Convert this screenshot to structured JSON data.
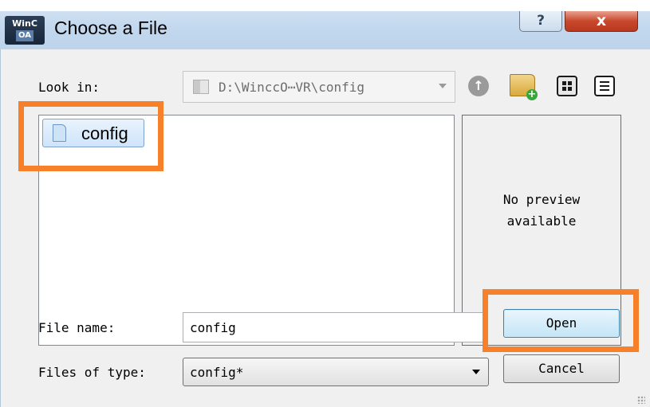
{
  "window": {
    "title": "Choose a File",
    "app_icon_top": "WinC",
    "app_icon_bottom": "OA",
    "help_glyph": "?",
    "close_glyph": "x"
  },
  "look_in": {
    "label": "Look in:",
    "path": "D:\\WinccO⋯VR\\config"
  },
  "toolbar": {
    "icons": [
      "up-arrow-icon",
      "new-folder-icon",
      "list-view-icon",
      "detail-view-icon"
    ]
  },
  "file_list": {
    "items": [
      {
        "name": "config",
        "icon": "document-icon",
        "selected": true
      }
    ]
  },
  "preview": {
    "text": "No preview\navailable"
  },
  "file_name": {
    "label": "File name:",
    "value": "config"
  },
  "files_of_type": {
    "label": "Files of type:",
    "value": "config*"
  },
  "buttons": {
    "open": "Open",
    "cancel": "Cancel"
  },
  "colors": {
    "highlight": "#f7802a",
    "selection": "#cfe4fa"
  }
}
